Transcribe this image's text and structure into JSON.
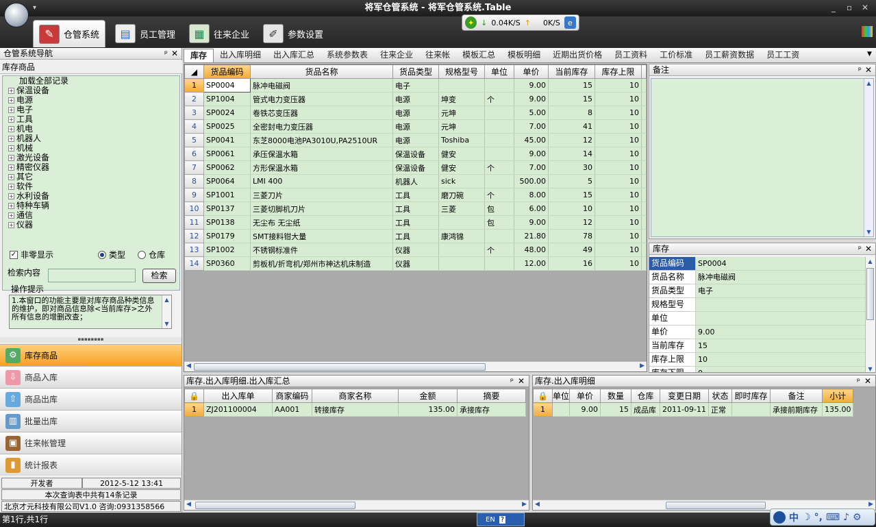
{
  "window": {
    "title": "将军仓管系统 - 将军仓管系统.Table",
    "min": "_",
    "restore": "▫",
    "close": "✕",
    "qa": "▾"
  },
  "ribbon_tabs": [
    {
      "label": "仓管系统",
      "icon": "warehouse-icon"
    },
    {
      "label": "员工管理",
      "icon": "staff-card-icon"
    },
    {
      "label": "往来企业",
      "icon": "company-icon"
    },
    {
      "label": "参数设置",
      "icon": "settings-pen-icon"
    }
  ],
  "network": {
    "down": "0.04K/S",
    "up": "0K/S"
  },
  "nav_panel": {
    "title": "仓管系统导航",
    "pin": "ᵖ",
    "close": "✕",
    "tree_header": "库存商品",
    "tree_root": "加载全部记录",
    "tree_items": [
      "保温设备",
      "电源",
      "电子",
      "工具",
      "机电",
      "机器人",
      "机械",
      "激光设备",
      "精密仪器",
      "其它",
      "软件",
      "水利设备",
      "特种车辆",
      "通信",
      "仪器"
    ],
    "nonzero_label": "非零显示",
    "radio_type": "类型",
    "radio_warehouse": "仓库",
    "search_label": "检索内容",
    "search_button": "检索",
    "tip_label": "操作提示",
    "tip_text": "1.本窗口的功能主要是对库存商品种类信息的维护，即对商品信息除<当前库存>之外所有信息的增删改查；",
    "splitter": "▪▪▪▪▪▪▪▪",
    "nav_items": [
      {
        "label": "库存商品",
        "icon": "robot-icon"
      },
      {
        "label": "商品入库",
        "icon": "inbound-icon"
      },
      {
        "label": "商品出库",
        "icon": "outbound-icon"
      },
      {
        "label": "批量出库",
        "icon": "batch-outbound-icon"
      },
      {
        "label": "往来帐管理",
        "icon": "briefcase-icon"
      },
      {
        "label": "统计报表",
        "icon": "bar-chart-icon"
      }
    ],
    "developer_label": "开发者",
    "datetime": "2012-5-12 13:41",
    "record_info": "本次查询表中共有14条记录",
    "company": "北京才元科技有限公司V1.0 咨询:0931358566"
  },
  "doc_tabs": [
    "库存",
    "出入库明细",
    "出入库汇总",
    "系统参数表",
    "往来企业",
    "往来帐",
    "模板汇总",
    "模板明细",
    "近期出货价格",
    "员工资料",
    "工价标准",
    "员工薪资数据",
    "员工工资"
  ],
  "main_grid": {
    "columns": [
      "货品编码",
      "货品名称",
      "货品类型",
      "规格型号",
      "单位",
      "单价",
      "当前库存",
      "库存上限"
    ],
    "rows": [
      {
        "n": "1",
        "code": "SP0004",
        "name": "脉冲电磁阀",
        "type": "电子",
        "spec": "",
        "unit": "",
        "price": "9.00",
        "stock": "15",
        "max": "10"
      },
      {
        "n": "2",
        "code": "SP1004",
        "name": "管式电力变压器",
        "type": "电源",
        "spec": "坤变",
        "unit": "个",
        "price": "9.00",
        "stock": "15",
        "max": "10"
      },
      {
        "n": "3",
        "code": "SP0024",
        "name": "卷铁芯变压器",
        "type": "电源",
        "spec": "元坤",
        "unit": "",
        "price": "5.00",
        "stock": "8",
        "max": "10"
      },
      {
        "n": "4",
        "code": "SP0025",
        "name": "全密封电力变压器",
        "type": "电源",
        "spec": "元坤",
        "unit": "",
        "price": "7.00",
        "stock": "41",
        "max": "10"
      },
      {
        "n": "5",
        "code": "SP0041",
        "name": "东芝8000电池PA3010U,PA2510UR",
        "type": "电源",
        "spec": "Toshiba",
        "unit": "",
        "price": "45.00",
        "stock": "12",
        "max": "10"
      },
      {
        "n": "6",
        "code": "SP0061",
        "name": "承压保温水箱",
        "type": "保温设备",
        "spec": "健安",
        "unit": "",
        "price": "9.00",
        "stock": "14",
        "max": "10"
      },
      {
        "n": "7",
        "code": "SP0062",
        "name": "方形保温水箱",
        "type": "保温设备",
        "spec": "健安",
        "unit": "个",
        "price": "7.00",
        "stock": "30",
        "max": "10"
      },
      {
        "n": "8",
        "code": "SP0064",
        "name": "LMI 400",
        "type": "机器人",
        "spec": "sick",
        "unit": "",
        "price": "500.00",
        "stock": "5",
        "max": "10"
      },
      {
        "n": "9",
        "code": "SP1001",
        "name": "三菱刀片",
        "type": "工具",
        "spec": "磨刀碗",
        "unit": "个",
        "price": "8.00",
        "stock": "15",
        "max": "10"
      },
      {
        "n": "10",
        "code": "SP0137",
        "name": "三菱切脚机刀片",
        "type": "工具",
        "spec": "三菱",
        "unit": "包",
        "price": "6.00",
        "stock": "10",
        "max": "10"
      },
      {
        "n": "11",
        "code": "SP0138",
        "name": "无尘布 无尘纸",
        "type": "工具",
        "spec": "",
        "unit": "包",
        "price": "9.00",
        "stock": "12",
        "max": "10"
      },
      {
        "n": "12",
        "code": "SP0179",
        "name": "SMT接料钳大量",
        "type": "工具",
        "spec": "康鸿锦",
        "unit": "",
        "price": "21.80",
        "stock": "78",
        "max": "10"
      },
      {
        "n": "13",
        "code": "SP1002",
        "name": "不锈钢标准件",
        "type": "仪器",
        "spec": "",
        "unit": "个",
        "price": "48.00",
        "stock": "49",
        "max": "10"
      },
      {
        "n": "14",
        "code": "SP0360",
        "name": "剪板机/折弯机/郑州市神达机床制造",
        "type": "仪器",
        "spec": "",
        "unit": "",
        "price": "12.00",
        "stock": "16",
        "max": "10"
      }
    ]
  },
  "note_pane": {
    "title": "备注"
  },
  "detail_pane": {
    "title": "库存",
    "fields": [
      {
        "label": "货品编码",
        "value": "SP0004"
      },
      {
        "label": "货品名称",
        "value": "脉冲电磁阀"
      },
      {
        "label": "货品类型",
        "value": "电子"
      },
      {
        "label": "规格型号",
        "value": ""
      },
      {
        "label": "单位",
        "value": ""
      },
      {
        "label": "单价",
        "value": "9.00"
      },
      {
        "label": "当前库存",
        "value": "15"
      },
      {
        "label": "库存上限",
        "value": "10"
      },
      {
        "label": "库存下限",
        "value": "0"
      }
    ]
  },
  "bottom_left": {
    "title": "库存.出入库明细.出入库汇总",
    "columns": [
      "出入库单",
      "商家编码",
      "商家名称",
      "金额",
      "摘要"
    ],
    "rows": [
      {
        "n": "1",
        "doc": "ZJ201100004",
        "code": "AA001",
        "name": "转接库存",
        "amount": "135.00",
        "memo": "承接库存"
      }
    ]
  },
  "bottom_right": {
    "title": "库存.出入库明细",
    "columns": [
      "单位",
      "单价",
      "数量",
      "仓库",
      "变更日期",
      "状态",
      "即时库存",
      "备注",
      "小计"
    ],
    "rows": [
      {
        "n": "1",
        "unit": "",
        "price": "9.00",
        "qty": "15",
        "wh": "成品库",
        "date": "2011-09-11",
        "status": "正常",
        "instant": "",
        "note": "承接前期库存",
        "subtotal": "135.00"
      }
    ]
  },
  "status": {
    "text": "第1行,共1行",
    "ime_lang": "EN",
    "ime_help": "?",
    "tray_text": "中",
    "tray_moon": "☽"
  }
}
